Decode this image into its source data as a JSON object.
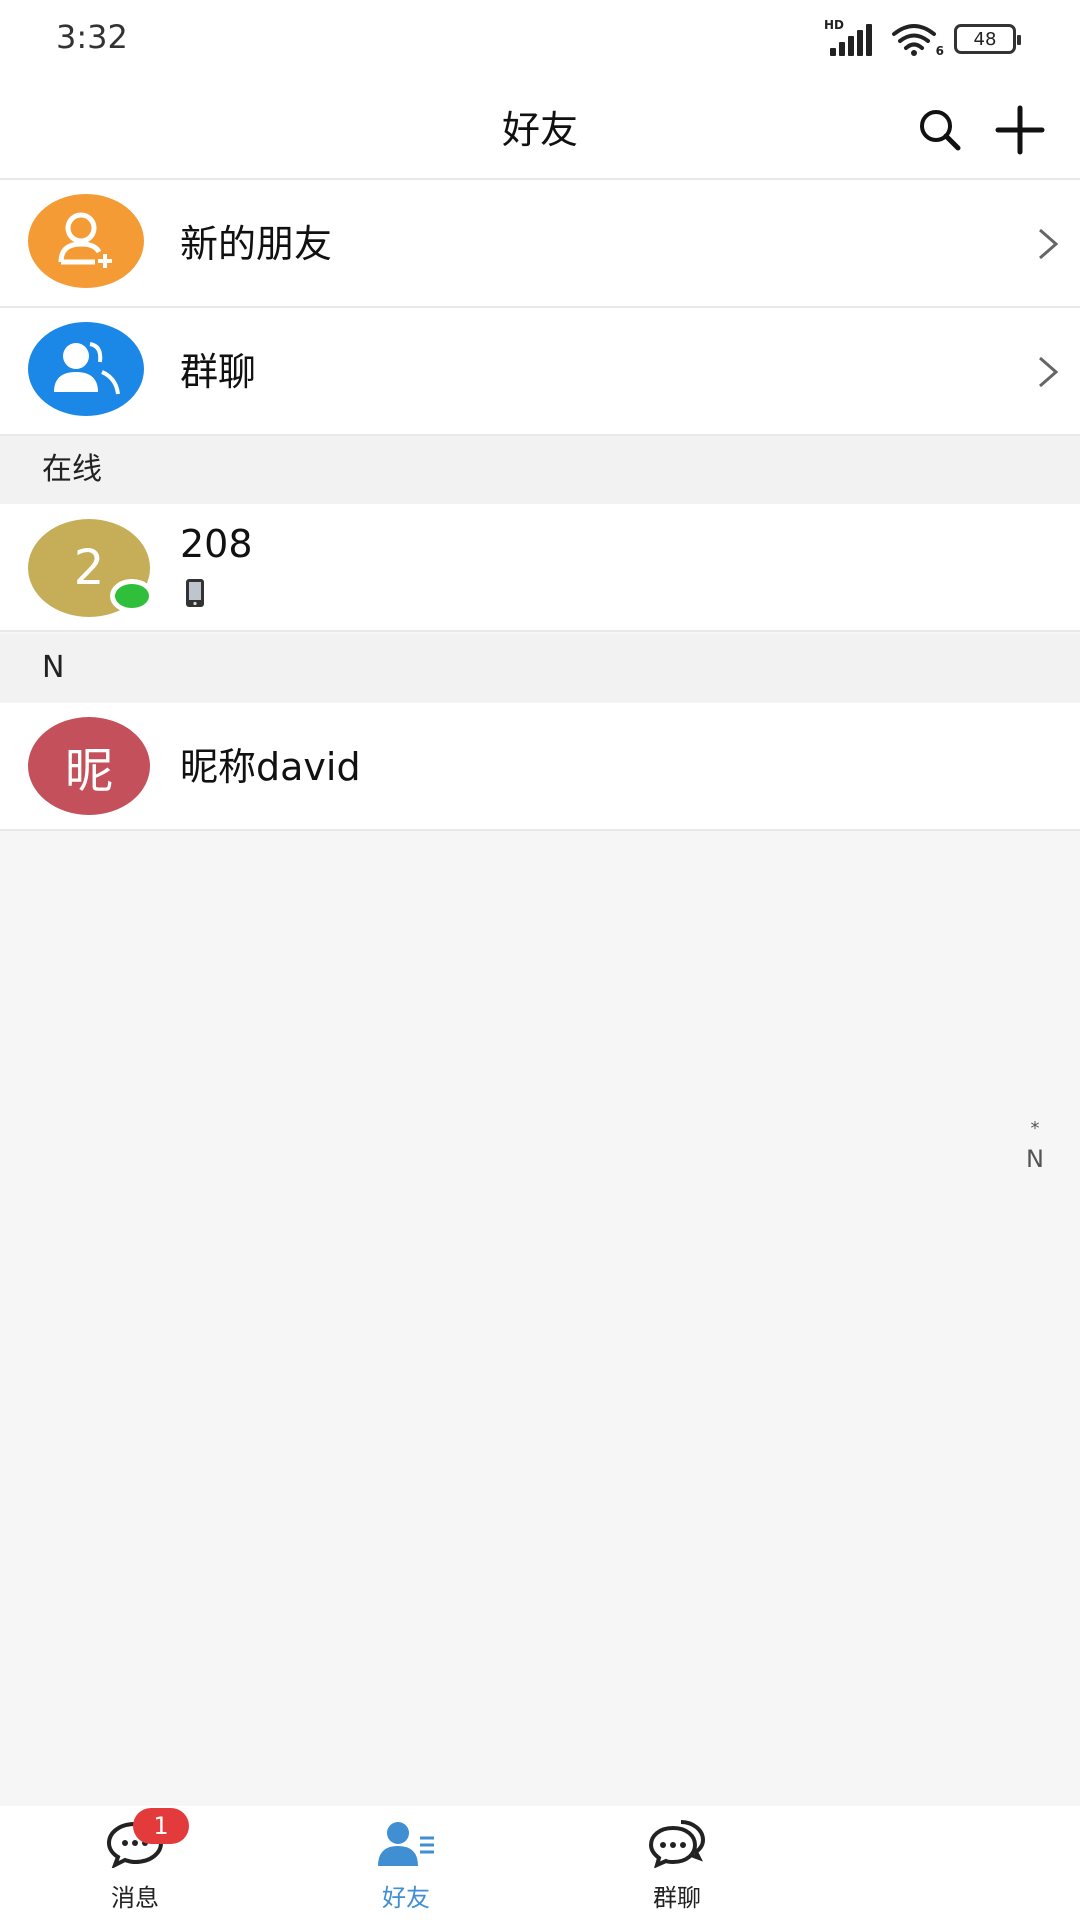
{
  "status_bar": {
    "time": "3:32",
    "network_label": "HD",
    "wifi_sub": "6",
    "battery": "48"
  },
  "header": {
    "title": "好友",
    "search_icon": "search-icon",
    "add_icon": "plus-icon"
  },
  "rows": {
    "new_friends": {
      "label": "新的朋友",
      "icon": "add-user-icon",
      "color": "#f59b35"
    },
    "group_chat": {
      "label": "群聊",
      "icon": "users-icon",
      "color": "#1b88e8"
    }
  },
  "sections": {
    "online": "在线",
    "n": "N"
  },
  "contacts": [
    {
      "avatar_text": "2",
      "name": "208",
      "online": true,
      "device": "phone-icon",
      "color": "#c6ae58"
    },
    {
      "avatar_text": "昵",
      "name": "昵称david",
      "online": false,
      "color": "#c3505a"
    }
  ],
  "index_bar": [
    "*",
    "N"
  ],
  "bottom_nav": {
    "messages": {
      "label": "消息",
      "badge": "1"
    },
    "friends": {
      "label": "好友",
      "active": true
    },
    "group": {
      "label": "群聊"
    }
  },
  "colors": {
    "accent": "#3f8fd2",
    "online_dot": "#2fbf3a",
    "badge": "#e33b3b"
  }
}
